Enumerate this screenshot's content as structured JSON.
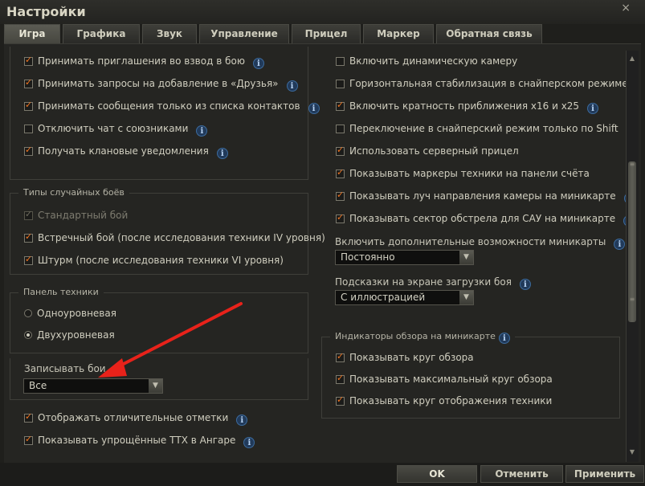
{
  "window": {
    "title": "Настройки",
    "close_glyph": "×"
  },
  "tabs": [
    {
      "label": "Игра",
      "active": true
    },
    {
      "label": "Графика"
    },
    {
      "label": "Звук"
    },
    {
      "label": "Управление"
    },
    {
      "label": "Прицел"
    },
    {
      "label": "Маркер"
    },
    {
      "label": "Обратная связь"
    }
  ],
  "left_top": {
    "items": [
      {
        "label": "Принимать приглашения во взвод в бою",
        "checked": true
      },
      {
        "label": "Принимать запросы на добавление в «Друзья»",
        "checked": true
      },
      {
        "label": "Принимать сообщения только из списка контактов",
        "checked": true
      },
      {
        "label": "Отключить чат с союзниками",
        "checked": false
      },
      {
        "label": "Получать клановые уведомления",
        "checked": true
      }
    ]
  },
  "random_battles": {
    "title": "Типы случайных боёв",
    "items": [
      {
        "label": "Стандартный бой",
        "checked": true,
        "disabled": true
      },
      {
        "label": "Встречный бой (после исследования техники IV уровня)",
        "checked": true
      },
      {
        "label": "Штурм (после исследования техники VI уровня)",
        "checked": true
      }
    ]
  },
  "vehicle_panel": {
    "title": "Панель техники",
    "options": [
      {
        "label": "Одноуровневая",
        "selected": false
      },
      {
        "label": "Двухуровневая",
        "selected": true
      }
    ]
  },
  "record_battles": {
    "label": "Записывать бои",
    "value": "Все"
  },
  "left_bottom": {
    "items": [
      {
        "label": "Отображать отличительные отметки",
        "checked": true
      },
      {
        "label": "Показывать упрощённые ТТХ в Ангаре",
        "checked": true
      }
    ]
  },
  "right_top": {
    "items": [
      {
        "label": "Включить динамическую камеру",
        "checked": false
      },
      {
        "label": "Горизонтальная стабилизация в снайперском режиме",
        "checked": false
      },
      {
        "label": "Включить кратность приближения x16 и x25",
        "checked": true
      },
      {
        "label": "Переключение в снайперский режим только по Shift",
        "checked": false
      },
      {
        "label": "Использовать серверный прицел",
        "checked": true
      },
      {
        "label": "Показывать маркеры техники на панели счёта",
        "checked": true
      },
      {
        "label": "Показывать луч направления камеры на миникарте",
        "checked": true
      },
      {
        "label": "Показывать сектор обстрела для САУ на миникарте",
        "checked": true
      }
    ]
  },
  "minimap_extra": {
    "label": "Включить дополнительные возможности миникарты",
    "value": "Постоянно"
  },
  "loading_tips": {
    "label": "Подсказки на экране загрузки боя",
    "value": "С иллюстрацией"
  },
  "minimap_indicators": {
    "title": "Индикаторы обзора на миникарте",
    "items": [
      {
        "label": "Показывать круг обзора",
        "checked": true
      },
      {
        "label": "Показывать максимальный круг обзора",
        "checked": true
      },
      {
        "label": "Показывать круг отображения техники",
        "checked": true
      }
    ]
  },
  "buttons": {
    "ok": "OK",
    "cancel": "Отменить",
    "apply": "Применить"
  },
  "icons": {
    "info": "i",
    "dropdown": "▼",
    "scroll_up": "▲",
    "scroll_down": "▼",
    "grip": "≡"
  },
  "colors": {
    "check": "#f07522",
    "annotation_arrow": "#e8221a"
  }
}
